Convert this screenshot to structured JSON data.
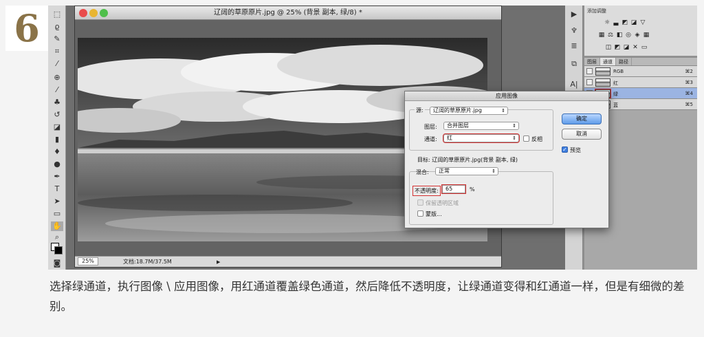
{
  "step_number": "6",
  "document": {
    "title": "辽阔的草原原片.jpg @ 25% (背景 副本, 绿/8) *",
    "zoom": "25%",
    "doc_info": "文档:18.7M/37.5M"
  },
  "toolbox_icons": [
    "marquee-icon",
    "lasso-icon",
    "quick-select-icon",
    "crop-icon",
    "eyedropper-icon",
    "spot-heal-icon",
    "brush-icon",
    "clone-stamp-icon",
    "history-brush-icon",
    "eraser-icon",
    "gradient-icon",
    "blur-icon",
    "dodge-icon",
    "pen-icon",
    "type-icon",
    "path-select-icon",
    "shape-icon",
    "hand-icon",
    "zoom-icon"
  ],
  "adjustments": {
    "title": "添加调整"
  },
  "channels_panel": {
    "tabs": [
      "图层",
      "通道",
      "路径"
    ],
    "active_tab": "通道",
    "channels": [
      {
        "name": "RGB",
        "shortcut": "⌘2",
        "selected": false
      },
      {
        "name": "红",
        "shortcut": "⌘3",
        "selected": false
      },
      {
        "name": "绿",
        "shortcut": "⌘4",
        "selected": true
      },
      {
        "name": "蓝",
        "shortcut": "⌘5",
        "selected": false
      }
    ]
  },
  "dialog": {
    "title": "应用图像",
    "source_label": "源:",
    "source_value": "辽阔的草原原片.jpg",
    "layer_label": "图层:",
    "layer_value": "合并图层",
    "channel_label": "通道:",
    "channel_value": "红",
    "invert_label": "反相",
    "target_text": "目标: 辽阔的草原原片.jpg(背景 副本, 绿)",
    "blending_label": "混合:",
    "blending_value": "正常",
    "opacity_label": "不透明度:",
    "opacity_value": "65",
    "opacity_unit": "%",
    "preserve_transparency_label": "保留透明区域",
    "mask_label": "蒙版...",
    "ok_label": "确定",
    "cancel_label": "取消",
    "preview_label": "预览",
    "preview_checked": true
  },
  "caption": "选择绿通道，执行图像 \\ 应用图像，用红通道覆盖绿色通道，然后降低不透明度，让绿通道变得和红通道一样，但是有细微的差别。"
}
